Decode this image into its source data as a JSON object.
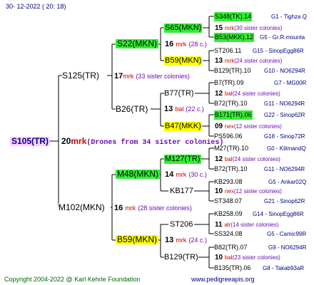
{
  "header": {
    "date": "30-  12-2022  ( 20:  18)"
  },
  "footer": {
    "copyright": "Copyright 2004-2022 @ Karl Kehrle Foundation",
    "website": "www.pedigreeapis.org"
  },
  "root": {
    "id": "S105(TR)",
    "num": "20",
    "mrk": "mrk",
    "note": "(Drones from 34 sister colonies)"
  },
  "sire_line": {
    "S125": {
      "id": "S125(TR)",
      "num": "17",
      "mrk": "mrk",
      "note": "(33 sister colonies)"
    },
    "S22": {
      "id": "S22(MKN)",
      "num": "16",
      "mrk": "mrk",
      "note": "(28 c.)"
    },
    "S65": {
      "id": "S65(MKN)",
      "num": "15",
      "mrk": "mrk",
      "note": "(30 sister colonies)"
    },
    "S348": {
      "id": "S348(TK).14",
      "src": "G1 - Tighza Q"
    },
    "B53": {
      "id": "B53(MKK).12",
      "src": "G5 - Gr.R.mounta"
    },
    "B59a": {
      "id": "B59(MKN)",
      "num": "13",
      "mrk": "mrk",
      "note": "(24 sister colonies)"
    },
    "ST206a": {
      "id": "ST206.11",
      "src": "G15 - SinopEgg86R"
    },
    "B129a": {
      "id": "B129(TR).10",
      "src": "G10 - NO6294R"
    },
    "B26": {
      "id": "B26(TR)",
      "num": "13",
      "mrk": "bal",
      "note": "(22 c.)"
    },
    "B77": {
      "id": "B77(TR)",
      "num": "12",
      "mrk": "bal",
      "note": "(24 sister colonies)"
    },
    "B7": {
      "id": "B7(TR).09",
      "src": "G7 - MG00R"
    },
    "B72a": {
      "id": "B72(TR).10",
      "src": "G11 - NO6294R"
    },
    "B47": {
      "id": "B47(MKK)",
      "num": "09",
      "mrk": "nex",
      "note": "(12 sister colonies)"
    },
    "B171": {
      "id": "B171(TR).06",
      "src": "G22 - Sinop62R"
    },
    "PS596": {
      "id": "PS596.06",
      "src": "G18 - Sinop72R"
    }
  },
  "dam_line": {
    "M102": {
      "id": "M102(MKN)",
      "num": "16",
      "mrk": "mrk",
      "note": "(28 sister colonies)"
    },
    "M48": {
      "id": "M48(MKN)",
      "num": "14",
      "mrk": "mrk",
      "note": "(30 c.)"
    },
    "M127": {
      "id": "M127(TR)",
      "num": "12",
      "mrk": "bal",
      "note": "(24 sister colonies)"
    },
    "M27": {
      "id": "M27(TR).10",
      "src": "G0 - KilimandQ"
    },
    "B72b": {
      "id": "B72(TR).10",
      "src": "G11 - NO6294R"
    },
    "KB177": {
      "id": "KB177",
      "num": "10",
      "mrk": "nex",
      "note": "(12 sister colonies)"
    },
    "KB293": {
      "id": "KB293.08",
      "src": "G5 - Ankar02Q"
    },
    "ST348": {
      "id": "ST348.07",
      "src": "G21 - Sinop62R"
    },
    "B59b": {
      "id": "B59(MKN)",
      "num": "13",
      "mrk": "mrk",
      "note": "(24 c.)"
    },
    "ST206b": {
      "id": "ST206",
      "num": "11",
      "mrk": "alr",
      "note": "(14 sister colonies)"
    },
    "KB258": {
      "id": "KB258.09",
      "src": "G14 - SinopEgg86R"
    },
    "SS324": {
      "id": "SS324.08",
      "src": "G5 - Camic99R"
    },
    "B129b": {
      "id": "B129(TR)",
      "num": "10",
      "mrk": "bal",
      "note": "(23 sister colonies)"
    },
    "B82": {
      "id": "B82(TR).07",
      "src": "G9 - NO6294R"
    },
    "B135": {
      "id": "B135(TR).06",
      "src": "G8 - Takab93aR"
    }
  },
  "colors": {
    "green": "#33ee33",
    "yellow": "#ffff00",
    "pink": "#ffccff",
    "navy": "#000080",
    "red": "#cc0000",
    "purple": "#6a0dad"
  }
}
